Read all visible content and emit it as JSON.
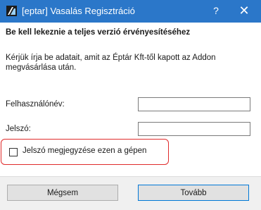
{
  "window": {
    "title": "[eptar] Vasalás Regisztráció",
    "help_symbol": "?",
    "close_symbol": "✕",
    "accent_color": "#2b77c9"
  },
  "content": {
    "heading": "Be kell lekeznie a teljes verzió érvényesítéséhez",
    "description": "Kérjük írja be adatait, amit az Éptár Kft-től kapott az Addon megvásárlása után."
  },
  "form": {
    "username_label": "Felhasználónév:",
    "username_value": "",
    "password_label": "Jelszó:",
    "password_value": "",
    "remember_label": "Jelszó megjegyzése ezen a gépen",
    "remember_checked": false,
    "highlight_color": "#e02b2b"
  },
  "buttons": {
    "cancel_label": "Mégsem",
    "next_label": "Tovább"
  }
}
